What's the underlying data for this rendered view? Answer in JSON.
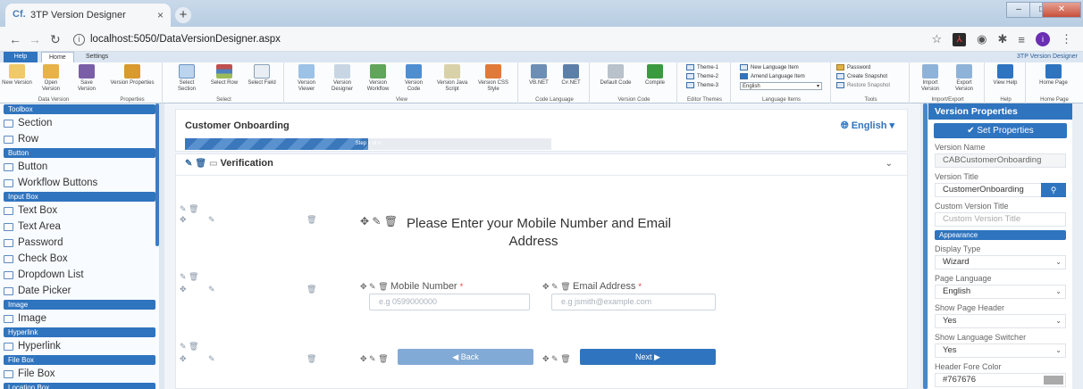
{
  "browser": {
    "tab_title": "3TP Version Designer",
    "url": "localhost:5050/DataVersionDesigner.aspx"
  },
  "ribbon": {
    "tabs": [
      "Help",
      "Home",
      "Settings"
    ],
    "brand": "3TP Version Designer",
    "groups": {
      "data_version": {
        "label": "Data Version",
        "buttons": [
          "New Version",
          "Open Version",
          "Save Version",
          "Version Properties"
        ]
      },
      "properties": {
        "label": "Properties"
      },
      "select": {
        "label": "Select",
        "buttons": [
          "Select Section",
          "Select Row",
          "Select Field"
        ]
      },
      "view": {
        "label": "View",
        "buttons": [
          "Version Viewer",
          "Version Designer",
          "Version Workflow",
          "Version Code",
          "Version Java Script",
          "Version CSS Style"
        ]
      },
      "code_language": {
        "label": "Code Language",
        "buttons": [
          "VB.NET",
          "C#.NET"
        ]
      },
      "version_code": {
        "label": "Version Code",
        "buttons": [
          "Default Code",
          "Compile"
        ]
      },
      "editor_themes": {
        "label": "Editor Themes",
        "buttons": [
          "Theme-1",
          "Theme-2",
          "Theme-3"
        ]
      },
      "language_items": {
        "label": "Language Items",
        "buttons": [
          "New Language Item",
          "Amend Language Item"
        ],
        "combo": "English"
      },
      "tools": {
        "label": "Tools",
        "buttons": [
          "Password",
          "Create Snapshot",
          "Restore Snapshot"
        ]
      },
      "import_export": {
        "label": "Import/Export",
        "buttons": [
          "Import Version",
          "Export Version"
        ]
      },
      "help": {
        "label": "Help",
        "buttons": [
          "View Help"
        ]
      },
      "home_page": {
        "label": "Home Page",
        "buttons": [
          "Home Page"
        ]
      }
    }
  },
  "toolbox": {
    "header": "Toolbox",
    "sections": [
      {
        "header": null,
        "items": [
          "Section",
          "Row"
        ]
      },
      {
        "header": "Button",
        "items": [
          "Button",
          "Workflow Buttons"
        ]
      },
      {
        "header": "Input Box",
        "items": [
          "Text Box",
          "Text Area",
          "Password",
          "Check Box",
          "Dropdown List",
          "Date Picker"
        ]
      },
      {
        "header": "Image",
        "items": [
          "Image"
        ]
      },
      {
        "header": "Hyperlink",
        "items": [
          "Hyperlink"
        ]
      },
      {
        "header": "File Box",
        "items": [
          "File Box"
        ]
      },
      {
        "header": "Location Box",
        "items": []
      }
    ]
  },
  "designer": {
    "page_title": "Customer Onboarding",
    "language": "English",
    "progress_label": "Step x of n",
    "progress_fraction": 0.5,
    "section_title": "Verification",
    "heading": "Please Enter your Mobile Number and Email Address",
    "mobile_label": "Mobile Number",
    "mobile_placeholder": "e.g 0599000000",
    "email_label": "Email Address",
    "email_placeholder": "e.g jsmith@example.com",
    "back_label": "Back",
    "next_label": "Next",
    "required_mark": "*"
  },
  "properties": {
    "title": "Version Properties",
    "set_button": "Set Properties",
    "fields": {
      "version_name_label": "Version Name",
      "version_name": "CABCustomerOnboarding",
      "version_title_label": "Version Title",
      "version_title": "CustomerOnboarding",
      "custom_title_label": "Custom Version Title",
      "custom_title_placeholder": "Custom Version Title",
      "appearance": "Appearance",
      "display_type_label": "Display Type",
      "display_type": "Wizard",
      "page_language_label": "Page Language",
      "page_language": "English",
      "show_header_label": "Show Page Header",
      "show_header": "Yes",
      "show_switcher_label": "Show Language Switcher",
      "show_switcher": "Yes",
      "header_color_label": "Header Fore Color",
      "header_color": "#767676"
    }
  }
}
